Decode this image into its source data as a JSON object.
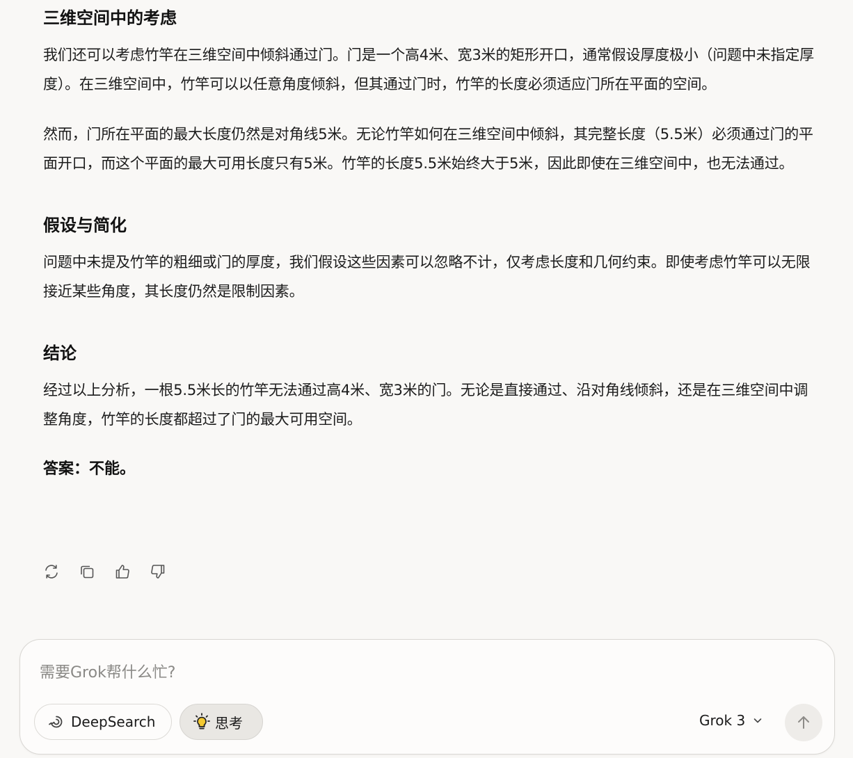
{
  "sections": [
    {
      "heading": "三维空间中的考虑",
      "paragraphs": [
        "我们还可以考虑竹竿在三维空间中倾斜通过门。门是一个高4米、宽3米的矩形开口，通常假设厚度极小（问题中未指定厚度）。在三维空间中，竹竿可以以任意角度倾斜，但其通过门时，竹竿的长度必须适应门所在平面的空间。",
        "然而，门所在平面的最大长度仍然是对角线5米。无论竹竿如何在三维空间中倾斜，其完整长度（5.5米）必须通过门的平面开口，而这个平面的最大可用长度只有5米。竹竿的长度5.5米始终大于5米，因此即使在三维空间中，也无法通过。"
      ]
    },
    {
      "heading": "假设与简化",
      "paragraphs": [
        "问题中未提及竹竿的粗细或门的厚度，我们假设这些因素可以忽略不计，仅考虑长度和几何约束。即使考虑竹竿可以无限接近某些角度，其长度仍然是限制因素。"
      ]
    },
    {
      "heading": "结论",
      "paragraphs": [
        "经过以上分析，一根5.5米长的竹竿无法通过高4米、宽3米的门。无论是直接通过、沿对角线倾斜，还是在三维空间中调整角度，竹竿的长度都超过了门的最大可用空间。"
      ]
    }
  ],
  "answer": "答案：不能。",
  "actions": {
    "icons": [
      "regenerate-icon",
      "copy-icon",
      "thumbs-up-icon",
      "thumbs-down-icon"
    ]
  },
  "composer": {
    "placeholder": "需要Grok帮什么忙?",
    "value": "",
    "deepsearch_label": "DeepSearch",
    "think_label": "思考",
    "model_label": "Grok 3"
  },
  "colors": {
    "background": "#f9f8f6",
    "composer_bg": "#fdfcfb",
    "think_active_bg": "#e9e7e3"
  }
}
